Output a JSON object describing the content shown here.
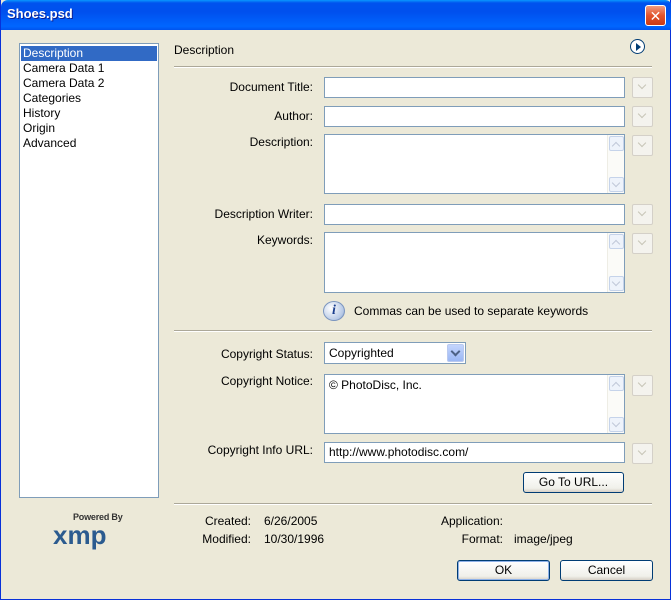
{
  "window": {
    "title": "Shoes.psd",
    "close_glyph": "✕"
  },
  "sidebar": {
    "items": [
      {
        "label": "Description",
        "selected": true
      },
      {
        "label": "Camera Data 1",
        "selected": false
      },
      {
        "label": "Camera Data 2",
        "selected": false
      },
      {
        "label": "Categories",
        "selected": false
      },
      {
        "label": "History",
        "selected": false
      },
      {
        "label": "Origin",
        "selected": false
      },
      {
        "label": "Advanced",
        "selected": false
      }
    ]
  },
  "logo": {
    "powered_by": "Powered By",
    "mark": "xmp"
  },
  "panel": {
    "section_title": "Description",
    "fields": {
      "document_title": {
        "label": "Document Title:",
        "value": ""
      },
      "author": {
        "label": "Author:",
        "value": ""
      },
      "description": {
        "label": "Description:",
        "value": ""
      },
      "description_writer": {
        "label": "Description Writer:",
        "value": ""
      },
      "keywords": {
        "label": "Keywords:",
        "value": ""
      }
    },
    "hint": {
      "icon": "info-icon",
      "glyph": "i",
      "text": "Commas can be used to separate keywords"
    },
    "copyright": {
      "status_label": "Copyright Status:",
      "status_value": "Copyrighted",
      "notice_label": "Copyright Notice:",
      "notice_value": "© PhotoDisc, Inc.",
      "url_label": "Copyright Info URL:",
      "url_value": "http://www.photodisc.com/",
      "go_to_url": "Go To URL..."
    }
  },
  "meta": {
    "created_label": "Created:",
    "created_value": "6/26/2005",
    "modified_label": "Modified:",
    "modified_value": "10/30/1996",
    "application_label": "Application:",
    "application_value": "",
    "format_label": "Format:",
    "format_value": "image/jpeg"
  },
  "buttons": {
    "ok": "OK",
    "cancel": "Cancel"
  },
  "colors": {
    "titlebar": "#0054e3",
    "selection": "#316ac5",
    "dialog_bg": "#ece9d8",
    "logo_blue": "#2b5b8f"
  }
}
